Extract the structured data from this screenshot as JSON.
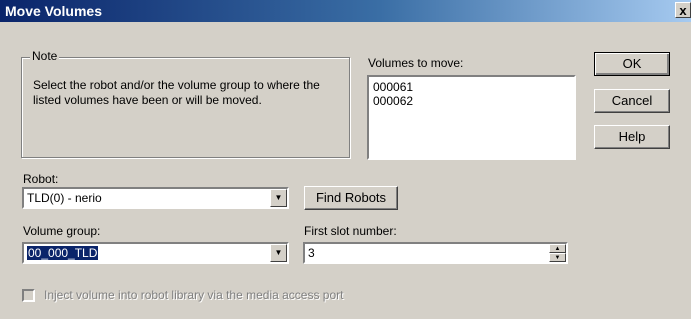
{
  "window": {
    "title": "Move Volumes",
    "close_glyph": "x"
  },
  "note": {
    "legend": "Note",
    "text": "Select the robot and/or the volume group to where the listed volumes have been or will be moved."
  },
  "volumes": {
    "label": "Volumes to move:",
    "items": [
      "000061",
      "000062"
    ]
  },
  "buttons": {
    "ok": "OK",
    "cancel": "Cancel",
    "help": "Help",
    "find_robots": "Find Robots"
  },
  "robot": {
    "label": "Robot:",
    "value": "TLD(0) - nerio"
  },
  "volume_group": {
    "label": "Volume group:",
    "value": "00_000_TLD"
  },
  "first_slot": {
    "label": "First slot number:",
    "value": "3"
  },
  "inject": {
    "label": "Inject volume into robot library via the media access port",
    "checked": false,
    "enabled": false
  },
  "icons": {
    "dropdown": "chevron-down-icon",
    "spin_up": "spin-up-icon",
    "spin_down": "spin-down-icon"
  }
}
